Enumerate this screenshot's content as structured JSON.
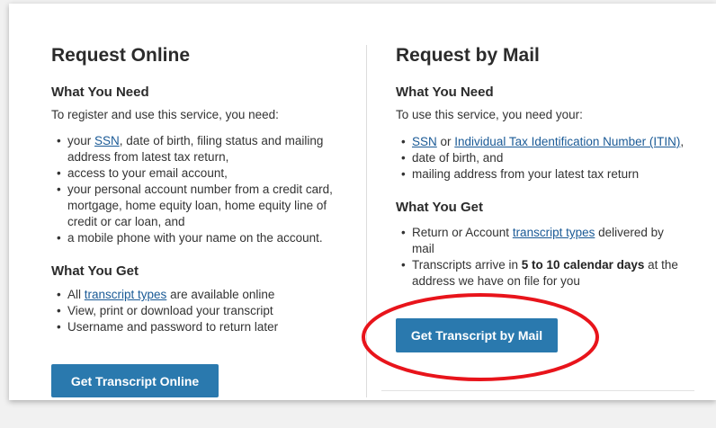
{
  "online": {
    "heading": "Request Online",
    "need_heading": "What You Need",
    "need_intro": "To register and use this service, you need:",
    "need_items": [
      {
        "pre": "your ",
        "link": "SSN",
        "post": ", date of birth, filing status and mailing address from latest tax return,"
      },
      {
        "text": "access to your email account,"
      },
      {
        "text": "your personal account number from a credit card, mortgage, home equity loan, home equity line of credit or car loan, and"
      },
      {
        "text": "a mobile phone with your name on the account."
      }
    ],
    "get_heading": "What You Get",
    "get_items": [
      {
        "pre": "All ",
        "link": "transcript types",
        "post": " are available online"
      },
      {
        "text": "View, print or download your transcript"
      },
      {
        "text": "Username and password to return later"
      }
    ],
    "button_label": "Get Transcript Online"
  },
  "mail": {
    "heading": "Request by Mail",
    "need_heading": "What You Need",
    "need_intro": "To use this service, you need your:",
    "need_items": [
      {
        "link1": "SSN",
        "mid": " or ",
        "link2": "Individual Tax Identification Number (ITIN)",
        "post": ","
      },
      {
        "text": "date of birth, and"
      },
      {
        "text": "mailing address from your latest tax return"
      }
    ],
    "get_heading": "What You Get",
    "get_items": [
      {
        "pre": "Return or Account ",
        "link": "transcript types",
        "post": " delivered by mail"
      },
      {
        "pre": "Transcripts arrive in ",
        "bold": "5 to 10 calendar days",
        "post": " at the address we have on file for you"
      }
    ],
    "button_label": "Get Transcript by Mail"
  },
  "colors": {
    "button_bg": "#2a79ae",
    "link": "#1a5a96",
    "highlight": "#e8141b"
  }
}
